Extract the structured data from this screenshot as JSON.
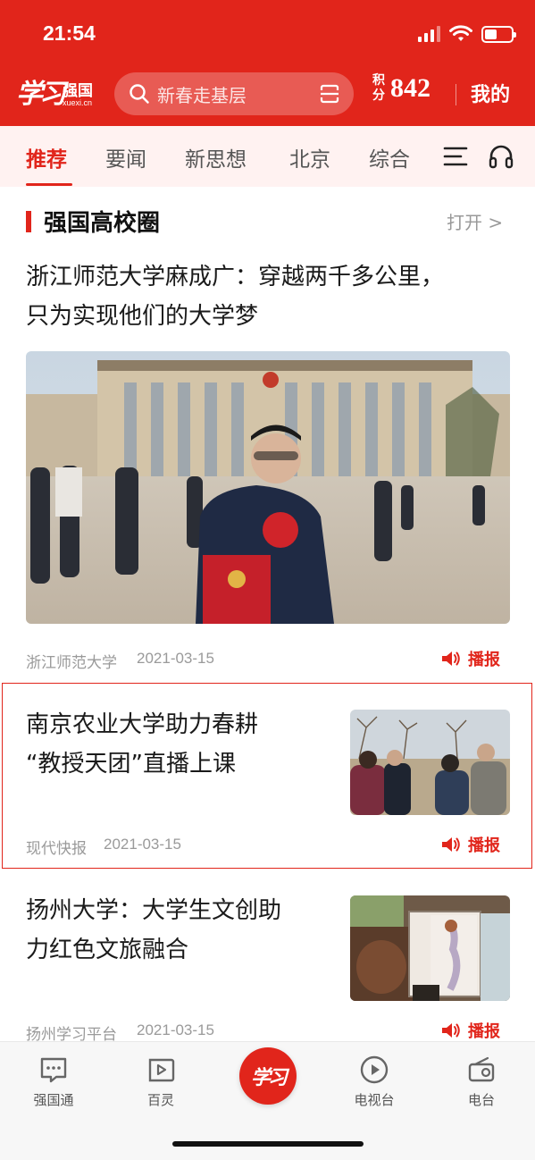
{
  "status_bar": {
    "time": "21:54",
    "icons": [
      "signal-icon",
      "wifi-icon",
      "battery-icon"
    ],
    "battery_level": 0.45
  },
  "header": {
    "logo_script": "学习",
    "logo_name": "强国",
    "logo_url": "xuexi.cn",
    "search_placeholder": "新春走基层",
    "points_label": "积分",
    "points_value": "842",
    "mine_label": "我的"
  },
  "tabs": {
    "items": [
      {
        "label": "推荐",
        "active": true
      },
      {
        "label": "要闻",
        "active": false
      },
      {
        "label": "新思想",
        "active": false
      },
      {
        "label": "北京",
        "active": false
      },
      {
        "label": "综合",
        "active": false
      }
    ],
    "extra_icons": [
      "menu-icon",
      "headphone-icon"
    ]
  },
  "section": {
    "title": "强国高校圈",
    "open_label": "打开 >"
  },
  "articles": [
    {
      "title": "浙江师范大学麻成广：穿越两千多公里，只为实现他们的大学梦",
      "title_lines": [
        "浙江师范大学麻成广：穿越两千多公里，",
        "只为实现他们的大学梦"
      ],
      "source": "浙江师范大学",
      "date": "2021-03-15",
      "broadcast_label": "播报",
      "image": "photo-great-hall"
    },
    {
      "title": "南京农业大学助力春耕“教授天团”直播上课",
      "title_lines": [
        "南京农业大学助力春耕",
        "“教授天团”直播上课"
      ],
      "source": "现代快报",
      "date": "2021-03-15",
      "broadcast_label": "播报",
      "image": "photo-orchard",
      "highlighted": true
    },
    {
      "title": "扬州大学：大学生文创助力红色文旅融合",
      "title_lines": [
        "扬州大学：大学生文创助",
        "力红色文旅融合"
      ],
      "source": "扬州学习平台",
      "date": "2021-03-15",
      "broadcast_label": "播报",
      "image": "photo-lantern"
    }
  ],
  "bottom_nav": {
    "items": [
      {
        "label": "强国通",
        "icon": "chat-icon"
      },
      {
        "label": "百灵",
        "icon": "bailing-icon"
      },
      {
        "label": "",
        "icon": "xuexi-center-icon",
        "center_text": "学习"
      },
      {
        "label": "电视台",
        "icon": "play-icon"
      },
      {
        "label": "电台",
        "icon": "radio-icon"
      }
    ]
  },
  "colors": {
    "brand_red": "#e1251b",
    "tab_bg": "#fff2f1",
    "meta_gray": "#9a9a9a"
  }
}
